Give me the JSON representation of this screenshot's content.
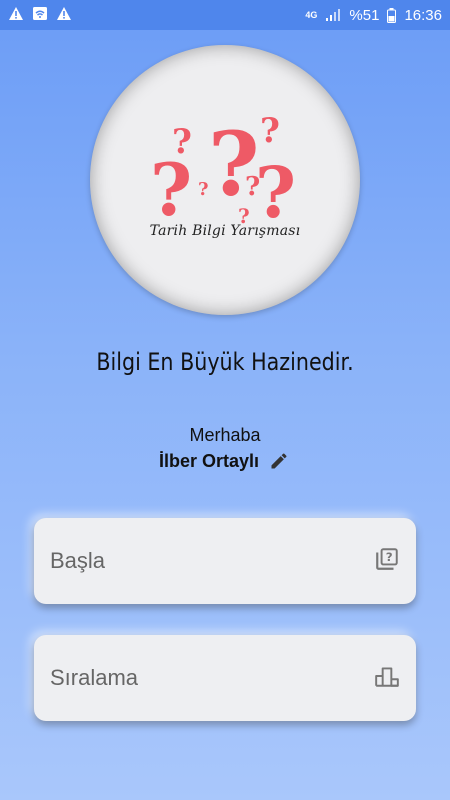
{
  "status_bar": {
    "left_icons": [
      "warning-icon",
      "wifi-icon",
      "warning-icon"
    ],
    "network": "4G",
    "battery": "%51",
    "time": "16:36"
  },
  "logo": {
    "title": "Tarih Bilgi Yarışması",
    "icon": "question-marks-icon",
    "accent": "#ee5a66"
  },
  "slogan": "Bilgi En Büyük Hazinedir.",
  "greeting": "Merhaba",
  "user": {
    "name": "İlber Ortaylı",
    "edit_icon": "pencil-icon"
  },
  "menu": {
    "start_label": "Başla",
    "start_icon": "quiz-icon",
    "ranking_label": "Sıralama",
    "ranking_icon": "leaderboard-icon"
  }
}
